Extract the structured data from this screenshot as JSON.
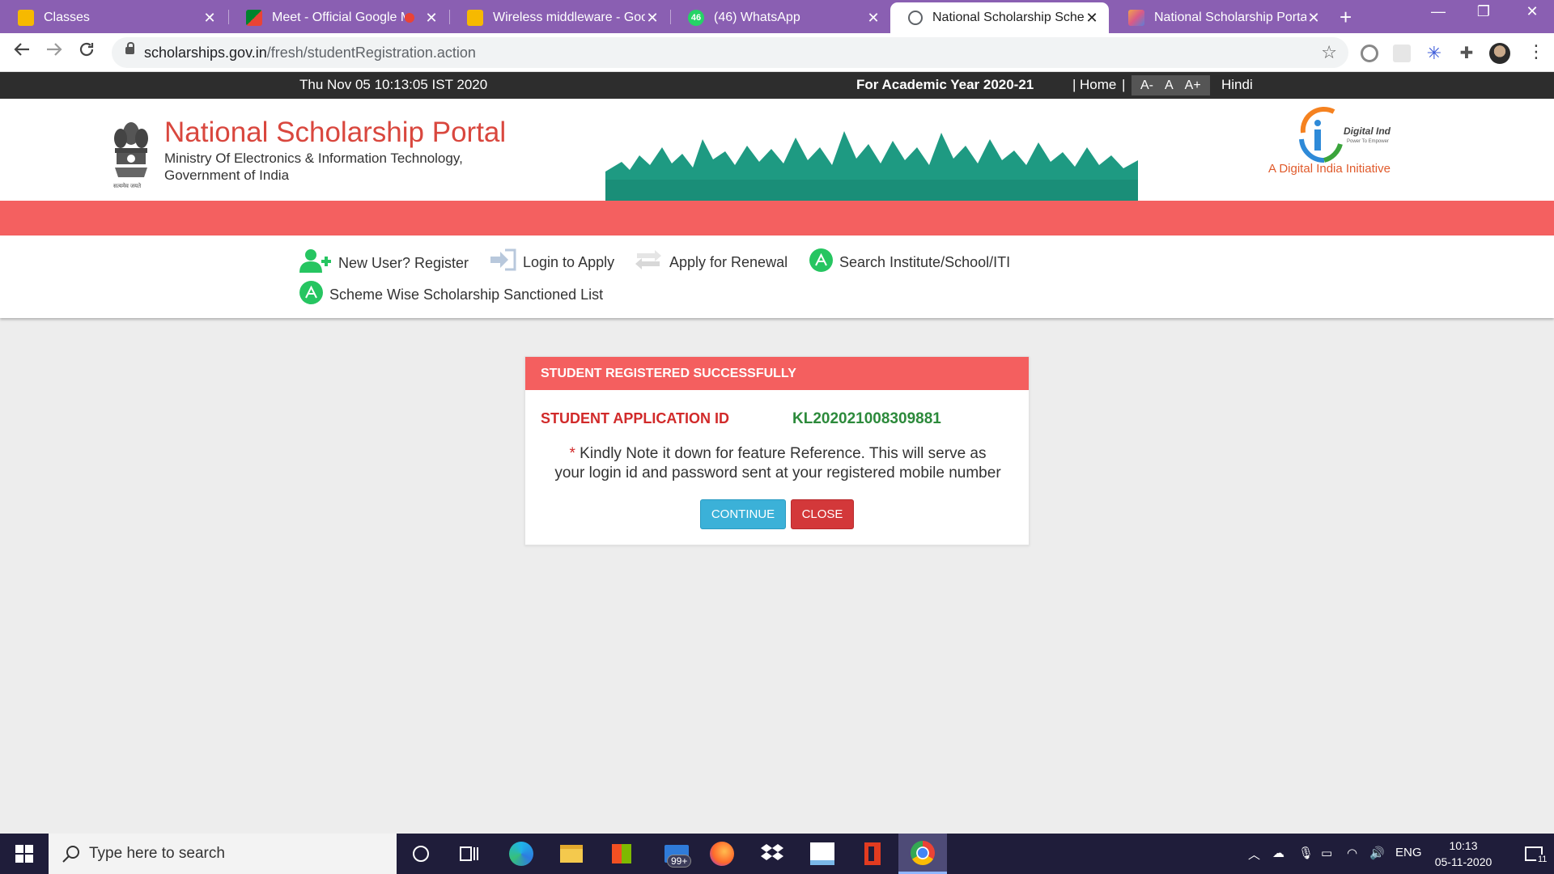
{
  "browser": {
    "tabs": [
      {
        "title": "Classes",
        "favicon_color": "#f6b900"
      },
      {
        "title": "Meet - Official Google M",
        "favicon_color": "#00832d"
      },
      {
        "title": "Wireless middleware - Googl",
        "favicon_color": "#f6b900"
      },
      {
        "title": "(46) WhatsApp",
        "favicon_color": "#25d366",
        "badge": "46"
      },
      {
        "title": "National Scholarship Scheme",
        "favicon_color": "#5f6368",
        "active": true
      },
      {
        "title": "National Scholarship Portal (",
        "favicon_color": "#d85a88"
      }
    ],
    "new_tab_symbol": "+",
    "window_controls": {
      "minimize": "—",
      "restore": "❐",
      "close": "✕"
    },
    "url_host": "scholarships.gov.in",
    "url_path": "/fresh/studentRegistration.action"
  },
  "site": {
    "datetime": "Thu Nov 05 10:13:05 IST 2020",
    "academic_year": "For Academic Year 2020-21",
    "separator": "|",
    "home": "Home",
    "font_small": "A-",
    "font_normal": "A",
    "font_large": "A+",
    "language": "Hindi",
    "title": "National Scholarship Portal",
    "ministry_line1": "Ministry Of Electronics & Information Technology,",
    "ministry_line2": "Government of India",
    "emblem_caption": "सत्यमेव जयते",
    "digital_india_logo": "Digital India",
    "digital_india_tagline": "Power To Empower",
    "digital_india_text": "A Digital India Initiative",
    "accent_red": "#f46060",
    "accent_green": "#26c561"
  },
  "nav": {
    "register": "New User? Register",
    "login": "Login to Apply",
    "renewal": "Apply for Renewal",
    "search_institute": "Search Institute/School/ITI",
    "sanctioned_list": "Scheme Wise Scholarship Sanctioned List"
  },
  "modal": {
    "header": "STUDENT REGISTERED SUCCESSFULLY",
    "app_id_label": "STUDENT APPLICATION ID",
    "app_id_value": "KL202021008309881",
    "note_asterisk": "*",
    "note_line1": "Kindly Note it down for feature Reference. This will serve as",
    "note_line2": "your login id and password sent at your registered mobile number",
    "continue_label": "CONTINUE",
    "close_label": "CLOSE"
  },
  "taskbar": {
    "search_placeholder": "Type here to search",
    "mail_badge": "99+",
    "language": "ENG",
    "time": "10:13",
    "date": "05-11-2020",
    "notification_count": "11"
  }
}
